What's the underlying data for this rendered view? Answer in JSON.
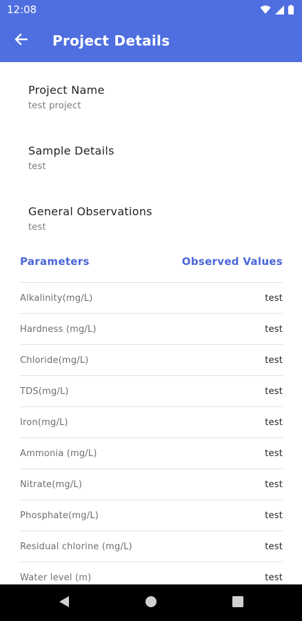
{
  "status_bar": {
    "time": "12:08"
  },
  "app_bar": {
    "title": "Project Details"
  },
  "project": {
    "name_label": "Project Name",
    "name_value": "test project",
    "sample_label": "Sample Details",
    "sample_value": "test",
    "observations_label": "General Observations",
    "observations_value": "test"
  },
  "table": {
    "header_param": "Parameters",
    "header_value": "Observed Values",
    "rows": [
      {
        "param": "Alkalinity(mg/L)",
        "value": "test"
      },
      {
        "param": "Hardness (mg/L)",
        "value": "test"
      },
      {
        "param": "Chloride(mg/L)",
        "value": "test"
      },
      {
        "param": "TDS(mg/L)",
        "value": "test"
      },
      {
        "param": "Iron(mg/L)",
        "value": "test"
      },
      {
        "param": "Ammonia (mg/L)",
        "value": "test"
      },
      {
        "param": "Nitrate(mg/L)",
        "value": "test"
      },
      {
        "param": "Phosphate(mg/L)",
        "value": "test"
      },
      {
        "param": "Residual chlorine (mg/L)",
        "value": "test"
      },
      {
        "param": "Water level (m)",
        "value": "test"
      }
    ]
  },
  "colors": {
    "app_bar": "#4f6fe0",
    "accent_text": "#4a66d8",
    "nav_bar": "#000000"
  },
  "icons": {
    "back": "arrow-left-icon",
    "wifi": "wifi-icon",
    "signal": "signal-icon",
    "battery": "battery-icon",
    "nav_back": "triangle-back-icon",
    "nav_home": "circle-home-icon",
    "nav_recents": "square-recents-icon"
  }
}
